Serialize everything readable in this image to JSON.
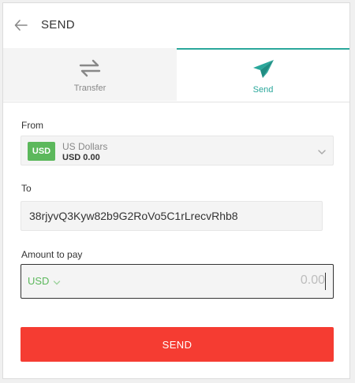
{
  "header": {
    "title": "SEND",
    "back_icon": "arrow-left-icon"
  },
  "tabs": [
    {
      "label": "Transfer",
      "icon": "transfer-arrows-icon",
      "active": false
    },
    {
      "label": "Send",
      "icon": "paper-plane-icon",
      "active": true
    }
  ],
  "form": {
    "from_label": "From",
    "from": {
      "badge": "USD",
      "name": "US Dollars",
      "balance": "USD 0.00"
    },
    "to_label": "To",
    "to_address": "38rjyvQ3Kyw82b9G2RoVo5C1rLrecvRhb8",
    "amount_label": "Amount to pay",
    "amount_currency": "USD",
    "amount_placeholder": "0.00"
  },
  "send_button_label": "SEND",
  "colors": {
    "accent": "#2aa79b",
    "badge_green": "#5cb85c",
    "send_red": "#f53c32"
  }
}
